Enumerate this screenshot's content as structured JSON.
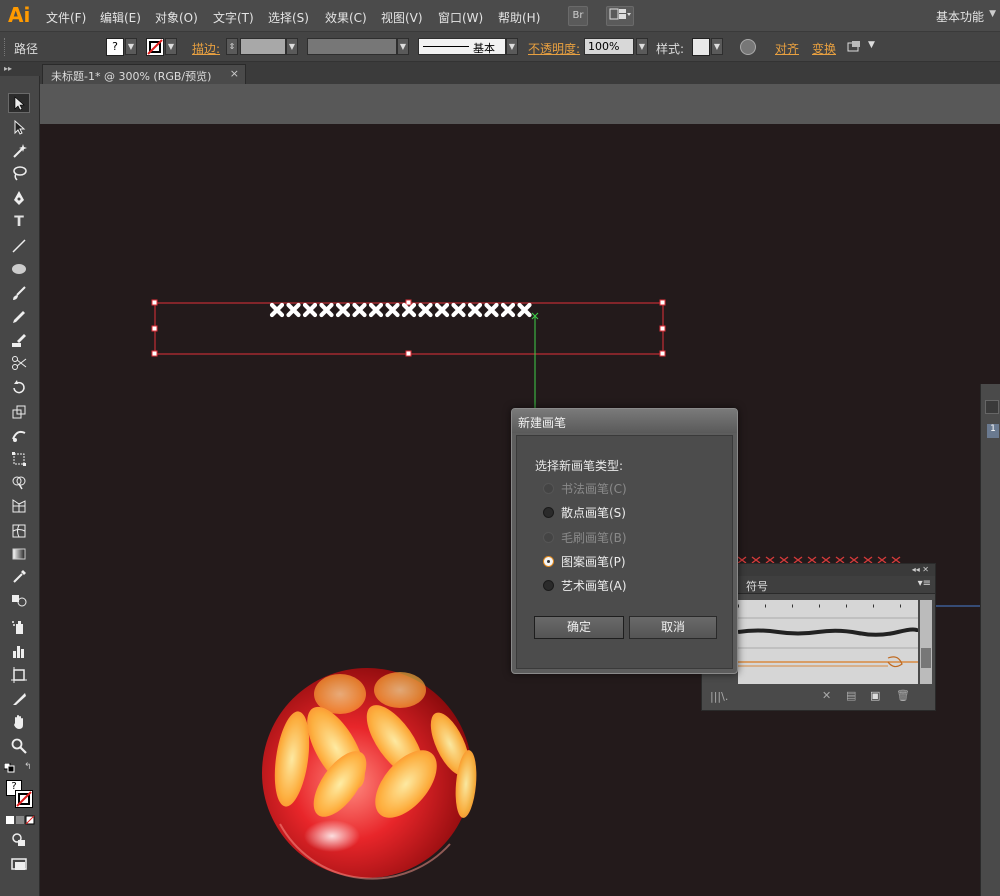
{
  "app": {
    "logo": "Ai"
  },
  "menu": {
    "items": [
      "文件(F)",
      "编辑(E)",
      "对象(O)",
      "文字(T)",
      "选择(S)",
      "效果(C)",
      "视图(V)",
      "窗口(W)",
      "帮助(H)"
    ],
    "bridge_label": "Br",
    "workspace": "基本功能"
  },
  "control_bar": {
    "selection_label": "路径",
    "stroke_label": "描边:",
    "stroke_style": "基本",
    "opacity_label": "不透明度:",
    "opacity_value": "100%",
    "style_label": "样式:",
    "align_label": "对齐",
    "transform_label": "变换",
    "fill_glyph": "?"
  },
  "document_tab": {
    "title": "未标题-1* @ 300% (RGB/预览)",
    "close": "×"
  },
  "dialog": {
    "title": "新建画笔",
    "prompt": "选择新画笔类型:",
    "options": [
      {
        "label": "书法画笔(C)",
        "enabled": false,
        "checked": false
      },
      {
        "label": "散点画笔(S)",
        "enabled": true,
        "checked": false
      },
      {
        "label": "毛刷画笔(B)",
        "enabled": false,
        "checked": false
      },
      {
        "label": "图案画笔(P)",
        "enabled": true,
        "checked": true
      },
      {
        "label": "艺术画笔(A)",
        "enabled": true,
        "checked": false
      }
    ],
    "ok_label": "确定",
    "cancel_label": "取消"
  },
  "brush_panel": {
    "tab_symbols": "符号",
    "header_controls": "◂◂ ✕",
    "menu_icon": "▾≡",
    "footer_left": "|||\\."
  },
  "right_panel": {
    "number": "1"
  },
  "colors": {
    "canvas": "#231a1b",
    "accent_orange": "#e8a040",
    "selection_red": "#e0303a",
    "guide_green": "#3fd04a"
  }
}
